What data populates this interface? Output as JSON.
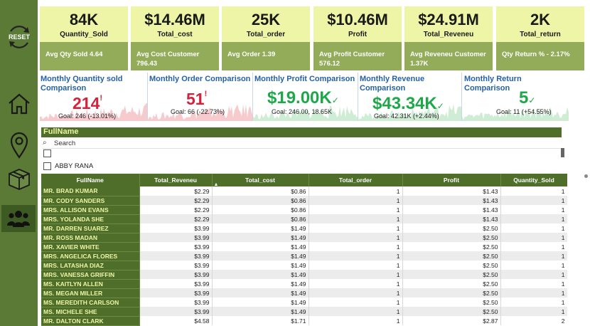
{
  "sidebar": {
    "reset_label": "RESET",
    "icons": [
      "reset-icon",
      "home-icon",
      "location-pin-icon",
      "box-icon",
      "users-icon"
    ]
  },
  "kpis": [
    {
      "value": "84K",
      "label": "Quantity_Sold",
      "sub": "Avg Qty Sold 4.64"
    },
    {
      "value": "$14.46M",
      "label": "Total_cost",
      "sub": "Avg Cost Customer 796.43"
    },
    {
      "value": "25K",
      "label": "Total_order",
      "sub": "Avg Order 1.39"
    },
    {
      "value": "$10.46M",
      "label": "Profit",
      "sub": "Avg Profit Customer 576.12"
    },
    {
      "value": "$24.91M",
      "label": "Total_Reveneu",
      "sub": "Avg Reveneu Customer 1.37K"
    },
    {
      "value": "2K",
      "label": "Total_return",
      "sub": "Qty Return % - 2.17%"
    }
  ],
  "comparisons": [
    {
      "title": "Monthly Quantity sold Comparison",
      "value": "214",
      "mark": "!",
      "goal": "Goal: 246 (-13.01%)",
      "status": "red"
    },
    {
      "title": "Monthly Order Comparison",
      "value": "51",
      "mark": "!",
      "goal": "Goal: 66 (-22.73%)",
      "status": "red"
    },
    {
      "title": "Monthly Profit Comparison",
      "value": "$19.00K",
      "mark": "✓",
      "goal": "Goal: 246.00, 18.65K",
      "status": "green"
    },
    {
      "title": "Monthly Revenue Comparison",
      "value": "$43.34K",
      "mark": "✓",
      "goal": "Goal: 42.31K (+2.44%)",
      "status": "green"
    },
    {
      "title": "Monthly Return Comparison",
      "value": "5",
      "mark": "✓",
      "goal": "Goal: 11 (+54.55%)",
      "status": "green"
    }
  ],
  "colors": {
    "red": "#d6213a",
    "green": "#1fa84a",
    "sidebar": "#5a7a35",
    "header": "#4e6e2a",
    "kpi_top": "#eef5a6"
  },
  "slicer": {
    "header": "FullName",
    "search_placeholder": "Search",
    "items": [
      "",
      "ABBY RANA"
    ]
  },
  "table": {
    "columns": [
      "FullName",
      "Total_Reveneu",
      "Total_cost",
      "Total_order",
      "Profit",
      "Quantity_Sold"
    ],
    "rows": [
      [
        "MR. BRAD KUMAR",
        "$2.29",
        "$0.86",
        "1",
        "$1.43",
        "1"
      ],
      [
        "MR. CODY SANDERS",
        "$2.29",
        "$0.86",
        "1",
        "$1.43",
        "1"
      ],
      [
        "MRS. ALLISON EVANS",
        "$2.29",
        "$0.86",
        "1",
        "$1.43",
        "1"
      ],
      [
        "MRS. YOLANDA SHE",
        "$2.29",
        "$0.86",
        "1",
        "$1.43",
        "1"
      ],
      [
        "MR. DARREN SUAREZ",
        "$3.99",
        "$1.49",
        "1",
        "$2.50",
        "1"
      ],
      [
        "MR. ROSS MADAN",
        "$3.99",
        "$1.49",
        "1",
        "$2.50",
        "1"
      ],
      [
        "MR. XAVIER WHITE",
        "$3.99",
        "$1.49",
        "1",
        "$2.50",
        "1"
      ],
      [
        "MRS. ANGELICA FLORES",
        "$3.99",
        "$1.49",
        "1",
        "$2.50",
        "1"
      ],
      [
        "MRS. LATASHA DIAZ",
        "$3.99",
        "$1.49",
        "1",
        "$2.50",
        "1"
      ],
      [
        "MRS. VANESSA GRIFFIN",
        "$3.99",
        "$1.49",
        "1",
        "$2.50",
        "1"
      ],
      [
        "MS. KAITLYN ALLEN",
        "$3.99",
        "$1.49",
        "1",
        "$2.50",
        "1"
      ],
      [
        "MS. MEGAN MILLER",
        "$3.99",
        "$1.49",
        "1",
        "$2.50",
        "1"
      ],
      [
        "MS. MEREDITH CARLSON",
        "$3.99",
        "$1.49",
        "1",
        "$2.50",
        "1"
      ],
      [
        "MS. MICHELE SHE",
        "$3.99",
        "$1.49",
        "1",
        "$2.50",
        "1"
      ],
      [
        "MR. DALTON CLARK",
        "$4.58",
        "$1.71",
        "1",
        "$2.87",
        "2"
      ]
    ]
  }
}
